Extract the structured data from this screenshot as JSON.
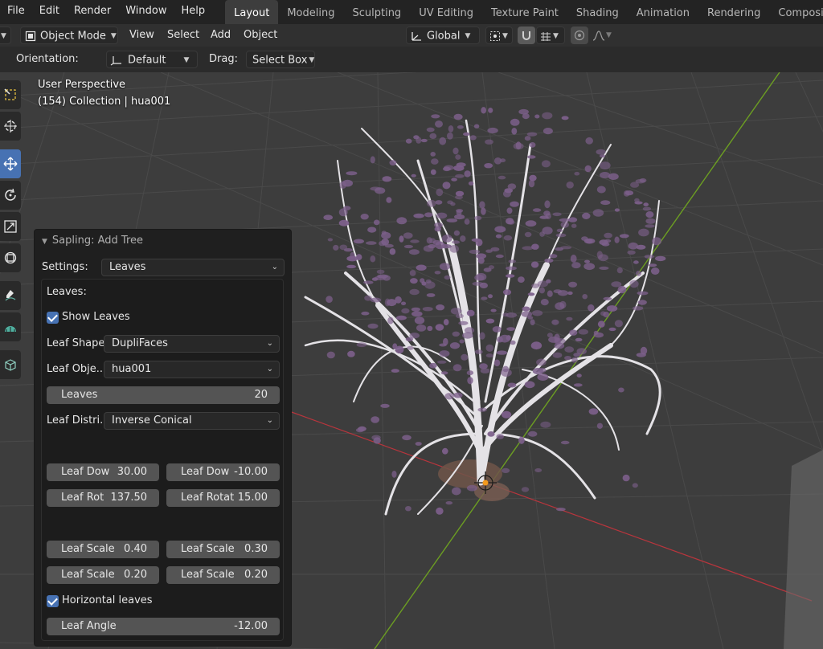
{
  "top_menu": [
    "File",
    "Edit",
    "Render",
    "Window",
    "Help"
  ],
  "workspaces": [
    "Layout",
    "Modeling",
    "Sculpting",
    "UV Editing",
    "Texture Paint",
    "Shading",
    "Animation",
    "Rendering",
    "Compositing"
  ],
  "active_workspace": "Layout",
  "header": {
    "mode": "Object Mode",
    "menus": [
      "View",
      "Select",
      "Add",
      "Object"
    ],
    "transform_orientation": "Global"
  },
  "tool_settings": {
    "orientation_label": "Orientation:",
    "orientation_value": "Default",
    "drag_label": "Drag:",
    "drag_value": "Select Box"
  },
  "viewport": {
    "perspective": "User Perspective",
    "collection": "(154) Collection | hua001"
  },
  "panel": {
    "title": "Sapling: Add Tree",
    "settings_label": "Settings:",
    "settings_value": "Leaves",
    "section_label": "Leaves:",
    "show_leaves_label": "Show Leaves",
    "leaf_shape_label": "Leaf Shape:",
    "leaf_shape_value": "DupliFaces",
    "leaf_object_label": "Leaf Obje...",
    "leaf_object_value": "hua001",
    "leaves_label": "Leaves",
    "leaves_value": "20",
    "leaf_dist_label": "Leaf Distri...",
    "leaf_dist_value": "Inverse Conical",
    "leaf_down_1_label": "Leaf Dow",
    "leaf_down_1_value": "30.00",
    "leaf_down_2_label": "Leaf Dow",
    "leaf_down_2_value": "-10.00",
    "leaf_rot_label": "Leaf Rot",
    "leaf_rot_value": "137.50",
    "leaf_rotat_label": "Leaf Rotat",
    "leaf_rotat_value": "15.00",
    "leaf_scale_1_label": "Leaf Scale",
    "leaf_scale_1_value": "0.40",
    "leaf_scale_2_label": "Leaf Scale",
    "leaf_scale_2_value": "0.30",
    "leaf_scale_3_label": "Leaf Scale",
    "leaf_scale_3_value": "0.20",
    "leaf_scale_4_label": "Leaf Scale",
    "leaf_scale_4_value": "0.20",
    "horizontal_leaves_label": "Horizontal leaves",
    "leaf_angle_label": "Leaf Angle",
    "leaf_angle_value": "-12.00"
  },
  "colors": {
    "accent": "#4772b3",
    "grid_x_axis": "#b8353d",
    "grid_y_axis": "#6c9e22",
    "leaf": "#7c5f8a"
  }
}
